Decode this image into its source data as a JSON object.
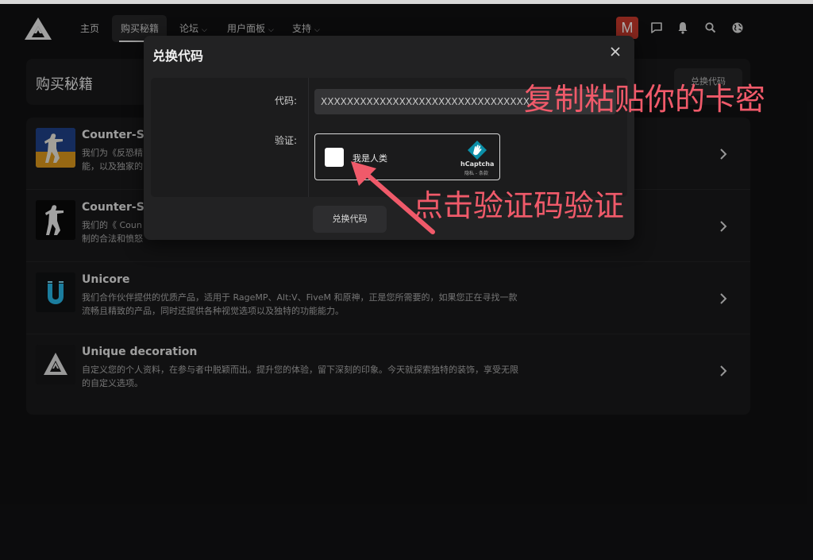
{
  "nav": {
    "home": "主页",
    "buy_cheats": "购买秘籍",
    "forum": "论坛",
    "user_panel": "用户面板",
    "support": "支持",
    "avatar_letter": "M"
  },
  "page": {
    "title": "购买秘籍",
    "redeem_button": "兑换代码"
  },
  "products": [
    {
      "title": "Counter-St",
      "desc_line1": "我们为《反恐精",
      "desc_line2": "能，以及独家的"
    },
    {
      "title": "Counter-St",
      "desc_line1": "我们的《 Coun",
      "desc_line2": "制的合法和愤怒"
    },
    {
      "title": "Unicore",
      "desc_line1": "我们合作伙伴提供的优质产品，适用于 RageMP、Alt:V、FiveM 和原神，正是您所需要的，如果您正在寻找一款",
      "desc_line2": "流畅且精致的产品，同时还提供各种视觉选项以及独特的功能能力。"
    },
    {
      "title": "Unique decoration",
      "desc_line1": "自定义您的个人资料，在参与者中脱颖而出。提升您的体验，留下深刻的印象。今天就探索独特的装饰，享受无限",
      "desc_line2": "的自定义选项。"
    }
  ],
  "modal": {
    "title": "兑换代码",
    "code_label": "代码:",
    "code_value": "XXXXXXXXXXXXXXXXXXXXXXXXXXXXXXXX",
    "verify_label": "验证:",
    "captcha_text": "我是人类",
    "captcha_brand": "hCaptcha",
    "captcha_links": "隐私 - 条款",
    "submit_button": "兑换代码"
  },
  "annotations": {
    "paste_hint": "复制粘贴你的卡密",
    "captcha_hint": "点击验证码验证"
  },
  "colors": {
    "background": "#111112",
    "panel": "#19191a",
    "modal": "#222223",
    "avatar": "#c4392c",
    "annotation": "#f05a6a"
  }
}
